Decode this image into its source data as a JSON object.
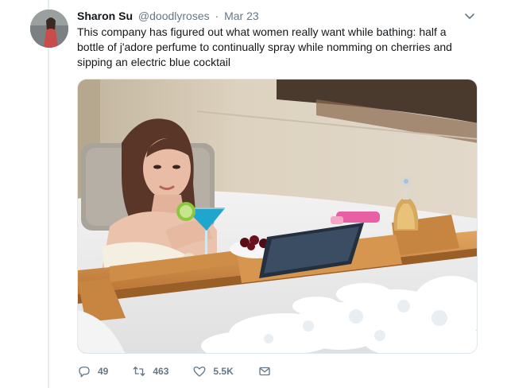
{
  "tweet": {
    "author_name": "Sharon Su",
    "author_handle": "@doodlyroses",
    "separator": "·",
    "timestamp": "Mar 23",
    "text": "This company has figured out what women really want while bathing: half a bottle of j'adore perfume to continually spray while nomming on cherries and sipping an electric blue cocktail"
  },
  "actions": {
    "replies": "49",
    "retweets": "463",
    "likes": "5.5K"
  },
  "icons": {
    "more": "chevron-down-icon",
    "reply": "reply-icon",
    "retweet": "retweet-icon",
    "like": "heart-icon",
    "message": "envelope-icon"
  },
  "colors": {
    "secondary_text": "#657786",
    "thread_line": "#e6ecf0"
  }
}
